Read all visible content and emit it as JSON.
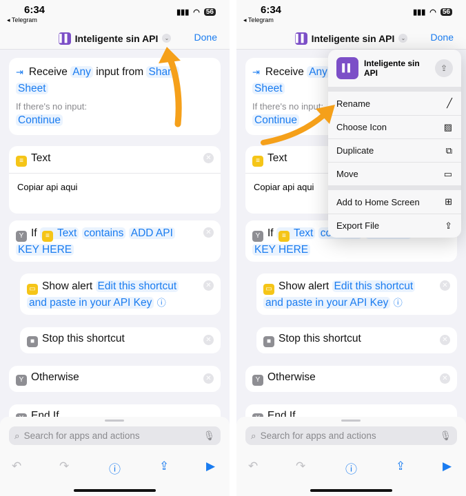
{
  "status": {
    "time": "6:34",
    "back": "◂ Telegram",
    "battery": "56"
  },
  "header": {
    "title": "Inteligente sin API",
    "done": "Done"
  },
  "receive": {
    "label": "Receive",
    "any": "Any",
    "from": "input from",
    "source1": "Share",
    "source2": "Sheet",
    "no_input": "If there's no input:",
    "continue": "Continue"
  },
  "text_action": {
    "label": "Text",
    "body": "Copiar api aqui"
  },
  "if_action": {
    "label": "If",
    "var": "Text",
    "op": "contains",
    "value1": "ADD API",
    "value2": "KEY HERE"
  },
  "alert": {
    "label": "Show alert",
    "msg1": "Edit this shortcut",
    "msg2": "and paste in your API Key"
  },
  "stop": {
    "label": "Stop this shortcut"
  },
  "otherwise": {
    "label": "Otherwise"
  },
  "endif": {
    "label": "End If"
  },
  "bottom": {
    "search_placeholder": "Search for apps and actions"
  },
  "menu": {
    "title": "Inteligente sin API",
    "items": [
      {
        "label": "Rename",
        "icon": "pencil-icon"
      },
      {
        "label": "Choose Icon",
        "icon": "photo-icon"
      },
      {
        "label": "Duplicate",
        "icon": "duplicate-icon"
      },
      {
        "label": "Move",
        "icon": "folder-icon"
      },
      {
        "label": "Add to Home Screen",
        "icon": "plus-square-icon"
      },
      {
        "label": "Export File",
        "icon": "share-icon"
      }
    ]
  },
  "colors": {
    "accent": "#1a7cf0",
    "shortcut_icon": "#7c4fc7",
    "annotation_arrow": "#f5a01a"
  }
}
